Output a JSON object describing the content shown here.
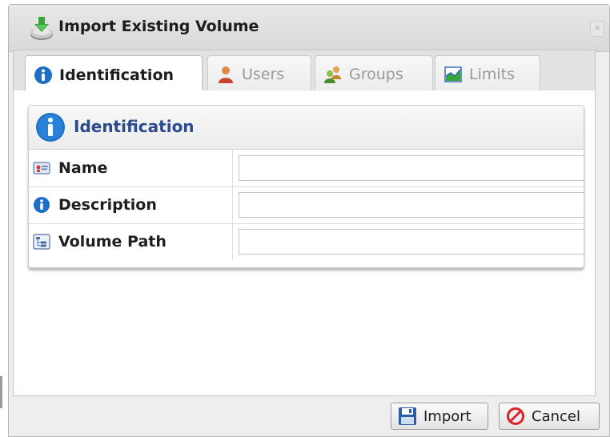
{
  "window": {
    "title": "Import Existing Volume",
    "close_label": "×"
  },
  "tabs": [
    {
      "label": "Identification",
      "icon": "info-icon",
      "active": true
    },
    {
      "label": "Users",
      "icon": "user-icon",
      "active": false
    },
    {
      "label": "Groups",
      "icon": "group-icon",
      "active": false
    },
    {
      "label": "Limits",
      "icon": "chart-icon",
      "active": false
    }
  ],
  "section": {
    "title": "Identification",
    "icon": "info-icon"
  },
  "fields": [
    {
      "label": "Name",
      "icon": "id-card-icon",
      "value": ""
    },
    {
      "label": "Description",
      "icon": "info-icon",
      "value": ""
    },
    {
      "label": "Volume Path",
      "icon": "folder-tree-icon",
      "value": ""
    }
  ],
  "buttons": {
    "import_label": "Import",
    "cancel_label": "Cancel"
  },
  "colors": {
    "info_blue": "#1c6fc4",
    "section_title": "#2a4a8c",
    "cancel_red": "#d8262b"
  }
}
